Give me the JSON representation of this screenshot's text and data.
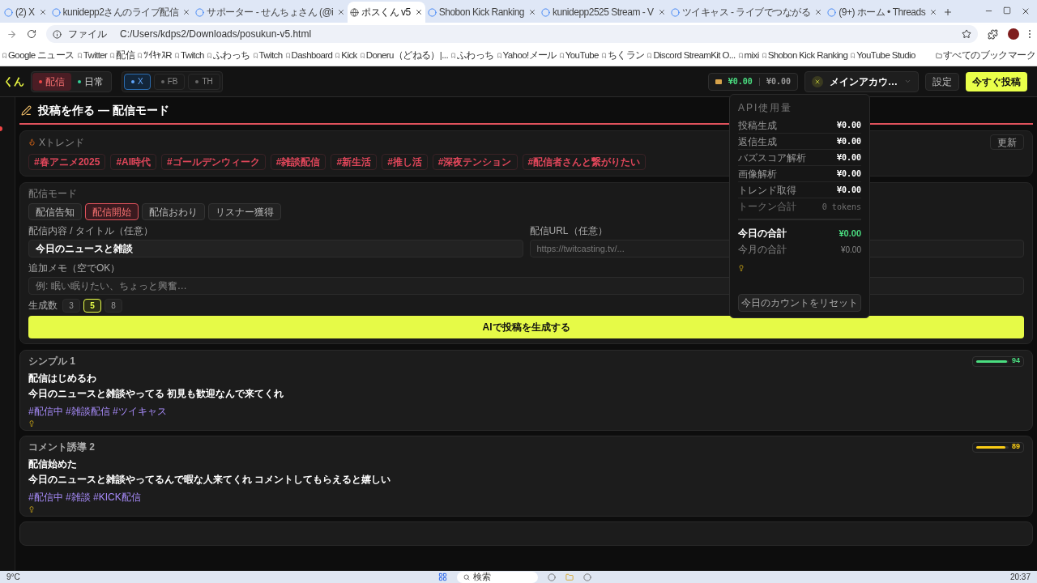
{
  "browser": {
    "tabs": [
      {
        "title": "(2) X",
        "selected": false
      },
      {
        "title": "kunidepp2さんのライブ配信",
        "selected": false
      },
      {
        "title": "サポーター - せんちょさん (@i",
        "selected": false
      },
      {
        "title": "ポスくん v5",
        "selected": true
      },
      {
        "title": "Shobon Kick Ranking",
        "selected": false
      },
      {
        "title": "kunidepp2525 Stream - V",
        "selected": false
      },
      {
        "title": "ツイキャス - ライブでつながる",
        "selected": false
      },
      {
        "title": "(9+) ホーム • Threads",
        "selected": false
      }
    ],
    "scheme": "ファイル",
    "address": "C:/Users/kdps2/Downloads/posukun-v5.html",
    "bookmarks": [
      "Google ニュース",
      "Twitter",
      "配信",
      "ﾂｲｷｬｽR",
      "Twitch",
      "ふわっち",
      "Twitch",
      "Dashboard",
      "Kick",
      "Doneru（どねる）|...",
      "ふわっち",
      "Yahoo!メール",
      "YouTube",
      "ちくラン",
      "Discord StreamKit O...",
      "mixi",
      "Shobon Kick Ranking",
      "YouTube Studio"
    ],
    "all_bookmarks": "すべてのブックマーク"
  },
  "header": {
    "logo": "くん",
    "modes": [
      {
        "label": "配信",
        "selected": true,
        "color": "#ef4444"
      },
      {
        "label": "日常",
        "selected": false,
        "color": "#34d399"
      }
    ],
    "platforms": [
      {
        "label": "X",
        "selected": true
      },
      {
        "label": "FB",
        "selected": false
      },
      {
        "label": "TH",
        "selected": false
      }
    ],
    "cost_today": "¥0.00",
    "cost_month": "¥0.00",
    "account": "メインアカウ…",
    "settings": "設定",
    "post_now": "今すぐ投稿"
  },
  "usage": {
    "title": "API使用量",
    "rows": [
      {
        "label": "投稿生成",
        "value": "¥0.00"
      },
      {
        "label": "返信生成",
        "value": "¥0.00"
      },
      {
        "label": "バズスコア解析",
        "value": "¥0.00"
      },
      {
        "label": "画像解析",
        "value": "¥0.00"
      },
      {
        "label": "トレンド取得",
        "value": "¥0.00"
      }
    ],
    "tokens_label": "トークン合計",
    "tokens": "0 tokens",
    "today_label": "今日の合計",
    "today": "¥0.00",
    "month_label": "今月の合計",
    "month": "¥0.00",
    "reset": "今日のカウントをリセット"
  },
  "page_title": "投稿を作る — 配信モード",
  "trends": {
    "label": "Xトレンド",
    "refresh": "更新",
    "tags": [
      "#春アニメ2025",
      "#AI時代",
      "#ゴールデンウィーク",
      "#雑談配信",
      "#新生活",
      "#推し活",
      "#深夜テンション",
      "#配信者さんと繋がりたい"
    ]
  },
  "composer": {
    "mode_label": "配信モード",
    "modes": [
      {
        "label": "配信告知",
        "selected": false
      },
      {
        "label": "配信開始",
        "selected": true
      },
      {
        "label": "配信おわり",
        "selected": false
      },
      {
        "label": "リスナー獲得",
        "selected": false
      }
    ],
    "title_label": "配信内容 / タイトル（任意）",
    "title_value": "今日のニュースと雑談",
    "url_label": "配信URL（任意）",
    "url_placeholder": "https://twitcasting.tv/...",
    "memo_label": "追加メモ（空でOK）",
    "memo_placeholder": "例: 眠い眠りたい、ちょっと興奮…",
    "count_label": "生成数",
    "counts": [
      {
        "label": "3",
        "selected": false
      },
      {
        "label": "5",
        "selected": true
      },
      {
        "label": "8",
        "selected": false
      }
    ],
    "generate": "AIで投稿を生成する"
  },
  "posts": [
    {
      "label": "シンプル 1",
      "score": "94",
      "level": 0.94,
      "color": "#4ade80",
      "title": "配信はじめるわ",
      "body": "今日のニュースと雑談やってる 初見も歓迎なんで来てくれ",
      "tags": "#配信中 #雑談配信 #ツイキャス"
    },
    {
      "label": "コメント誘導 2",
      "score": "89",
      "level": 0.89,
      "color": "#facc15",
      "title": "配信始めた",
      "body": "今日のニュースと雑談やってるんで暇な人来てくれ コメントしてもらえると嬉しい",
      "tags": "#配信中 #雑談 #KICK配信"
    }
  ],
  "taskbar": {
    "weather": "9°C",
    "search": "検索",
    "time": "20:37"
  }
}
